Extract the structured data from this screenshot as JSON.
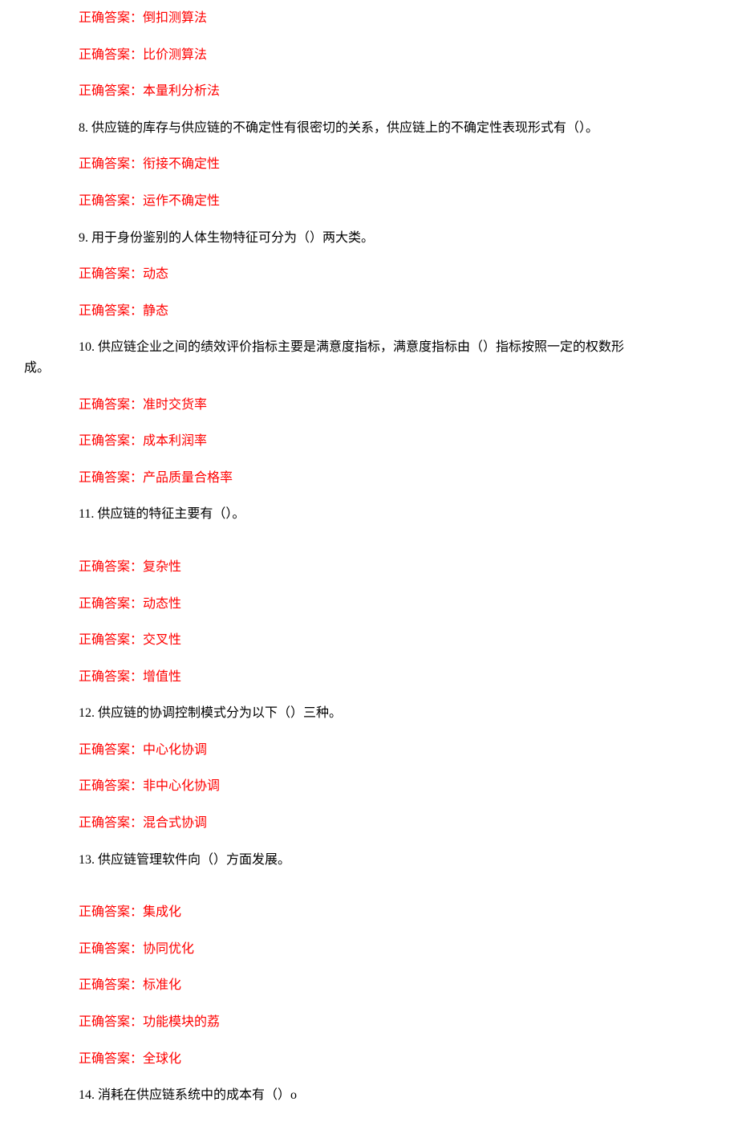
{
  "answers_top": [
    "正确答案：倒扣测算法",
    "正确答案：比价测算法",
    "正确答案：本量利分析法"
  ],
  "q8": {
    "text": "8.   供应链的库存与供应链的不确定性有很密切的关系，供应链上的不确定性表现形式有（）。",
    "answers": [
      "正确答案：衔接不确定性",
      "正确答案：运作不确定性"
    ]
  },
  "q9": {
    "text": "9.   用于身份鉴别的人体生物特征可分为（）两大类。",
    "answers": [
      "正确答案：动态",
      "正确答案：静态"
    ]
  },
  "q10": {
    "line1": "10.   供应链企业之间的绩效评价指标主要是满意度指标，满意度指标由（）指标按照一定的权数形",
    "line2": "成。",
    "answers": [
      "正确答案：准时交货率",
      "正确答案：成本利润率",
      "正确答案：产品质量合格率"
    ]
  },
  "q11": {
    "text": "11.   供应链的特征主要有（）。",
    "answers": [
      "正确答案：复杂性",
      "正确答案：动态性",
      "正确答案：交叉性",
      "正确答案：增值性"
    ]
  },
  "q12": {
    "text": "12.   供应链的协调控制模式分为以下（）三种。",
    "answers": [
      "正确答案：中心化协调",
      "正确答案：非中心化协调",
      "正确答案：混合式协调"
    ]
  },
  "q13": {
    "text": "13.   供应链管理软件向（）方面发展。",
    "answers": [
      "正确答案：集成化",
      "正确答案：协同优化",
      "正确答案：标准化",
      "正确答案：功能模块的荔",
      "正确答案：全球化"
    ]
  },
  "q14": {
    "text": "14.   消耗在供应链系统中的成本有（）o"
  }
}
